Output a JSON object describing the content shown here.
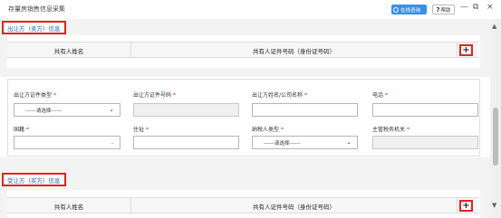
{
  "window": {
    "title": "存量房销售信息采集",
    "online_consult_label": "在线咨询",
    "help_label": "帮助",
    "minimize_glyph": "—",
    "restore_glyph": "⧉",
    "close_glyph": "×"
  },
  "seller_section": {
    "title": "出让方（卖方）信息",
    "columns": [
      "共有人姓名",
      "共有人证件号码（身份证号码）"
    ],
    "add_button": "+"
  },
  "form": {
    "required_mark": "*",
    "fields": [
      {
        "label": "出让方证件类型",
        "required": true,
        "type": "select",
        "value": "------请选择------"
      },
      {
        "label": "出让方证件号码",
        "required": true,
        "type": "text",
        "disabled": true,
        "value": ""
      },
      {
        "label": "出让方姓名/公司名称",
        "required": true,
        "type": "text",
        "disabled": false,
        "value": ""
      },
      {
        "label": "电话",
        "required": true,
        "type": "text",
        "disabled": false,
        "value": ""
      },
      {
        "label": "国籍",
        "required": true,
        "type": "select-small",
        "value": ""
      },
      {
        "label": "住址",
        "required": true,
        "type": "text",
        "disabled": false,
        "value": ""
      },
      {
        "label": "纳税人类型",
        "required": true,
        "type": "select",
        "value": "------请选择------"
      },
      {
        "label": "主管税务机关",
        "required": true,
        "type": "text",
        "disabled": true,
        "value": ""
      }
    ]
  },
  "buyer_section": {
    "title": "受让方（买方）信息",
    "columns": [
      "共有人姓名",
      "共有人证件号码（身份证号码）"
    ],
    "add_button": "+"
  },
  "icons": {
    "chevron": "⌄",
    "scroll_up": "▲",
    "scroll_down": "▼"
  }
}
